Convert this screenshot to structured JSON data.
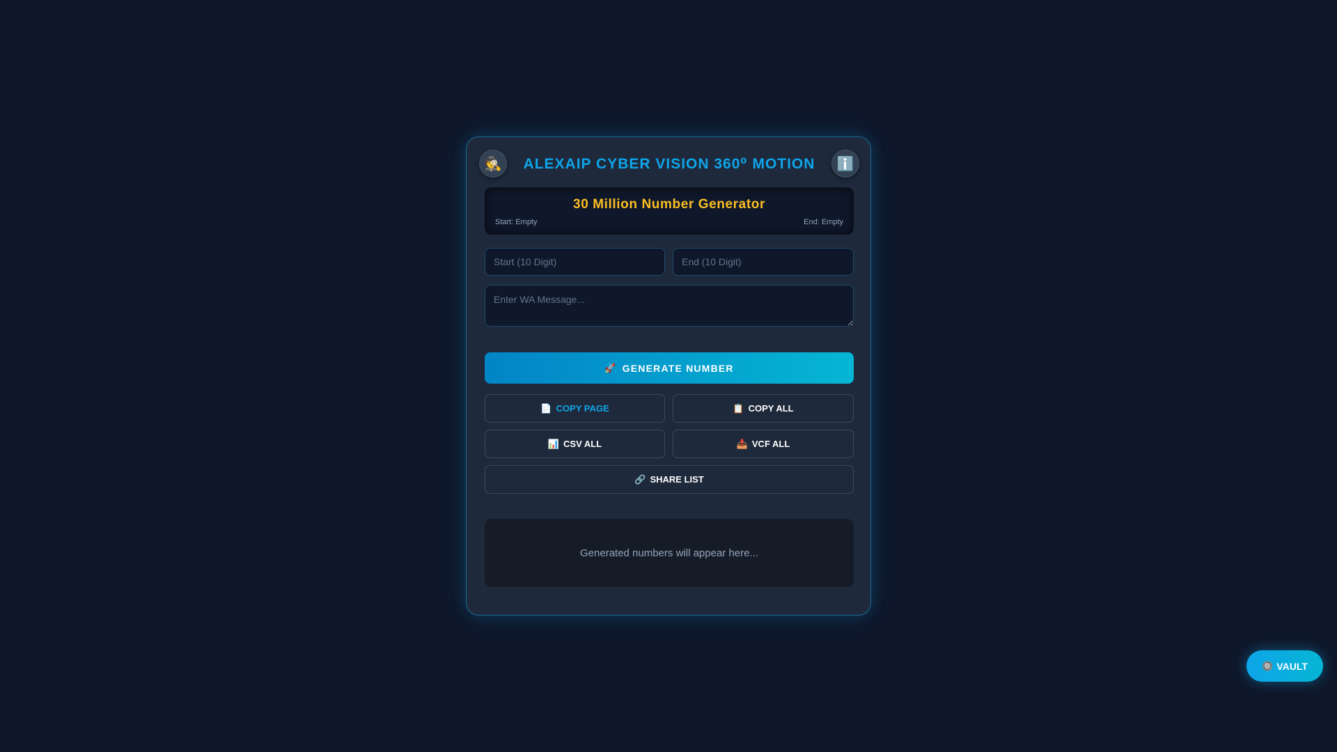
{
  "header": {
    "title": "ALEXAIP CYBER VISION 360⁰ MOTION",
    "left_icon": "🕵️",
    "right_icon": "ℹ️"
  },
  "generator": {
    "title": "30 Million Number Generator",
    "start_status": "Start: Empty",
    "end_status": "End: Empty"
  },
  "inputs": {
    "start_placeholder": "Start (10 Digit)",
    "end_placeholder": "End (10 Digit)",
    "message_placeholder": "Enter WA Message..."
  },
  "buttons": {
    "generate": {
      "icon": "🚀",
      "label": "GENERATE NUMBER"
    },
    "copy_page": {
      "icon": "📄",
      "label": "COPY PAGE"
    },
    "copy_all": {
      "icon": "📋",
      "label": "COPY ALL"
    },
    "csv_all": {
      "icon": "📊",
      "label": "CSV ALL"
    },
    "vcf_all": {
      "icon": "📥",
      "label": "VCF ALL"
    },
    "share_list": {
      "icon": "🔗",
      "label": "SHARE LIST"
    }
  },
  "results": {
    "placeholder": "Generated numbers will appear here..."
  },
  "vault": {
    "icon": "🔘",
    "label": "VAULT"
  },
  "colors": {
    "background": "#0f172a",
    "card": "#1e293b",
    "accent": "#0ea5e9",
    "gold": "#fbbf24"
  }
}
